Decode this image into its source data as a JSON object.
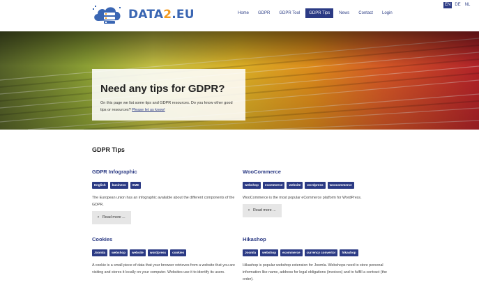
{
  "logo": {
    "text_data": "DATA",
    "text_two": "2",
    "text_eu": ".EU"
  },
  "nav": {
    "items": [
      {
        "label": "Home"
      },
      {
        "label": "GDPR"
      },
      {
        "label": "GDPR Tool"
      },
      {
        "label": "GDPR Tips",
        "active": true
      },
      {
        "label": "News"
      },
      {
        "label": "Contact"
      },
      {
        "label": "Login"
      }
    ]
  },
  "languages": [
    {
      "label": "EN",
      "active": true
    },
    {
      "label": "DE"
    },
    {
      "label": "NL"
    }
  ],
  "hero": {
    "title": "Need any tips for GDPR?",
    "text": "On this page we list some tips and GDPR resources. Do you know other good tips or resources? ",
    "link": "Please let us know!"
  },
  "section": {
    "title": "GDPR Tips"
  },
  "items": [
    {
      "title": "GDPR Infographic",
      "tags": [
        "English",
        "business",
        "SME"
      ],
      "description": "The European union has an infographic available about the different components of the GDPR.",
      "read_more": "Read more ..."
    },
    {
      "title": "WooCommerce",
      "tags": [
        "webshop",
        "ecommerce",
        "website",
        "wordpress",
        "woocommerce"
      ],
      "description": "WooCommerce is the most popular eCommerce platform for WordPress.",
      "read_more": "Read more ..."
    },
    {
      "title": "Cookies",
      "tags": [
        "Joomla",
        "webshop",
        "website",
        "wordpress",
        "cookies"
      ],
      "description": "A cookie is a small piece of data that your browser retrieves from a website that you are visiting and stores it locally on your computer. Websites use it to identify its users."
    },
    {
      "title": "Hikashop",
      "tags": [
        "Joomla",
        "webshop",
        "ecommerce",
        "currency convertor",
        "hikashop"
      ],
      "description": "Hikashop is popular webshop extension for Joomla. Webshops need to store personal information like name, address for legal obligations (invoices) and to fulfill a contract (the order)."
    }
  ],
  "colors": {
    "brand_blue": "#2b3a84",
    "logo_orange": "#f39a1e",
    "logo_blue": "#3a66b3"
  }
}
